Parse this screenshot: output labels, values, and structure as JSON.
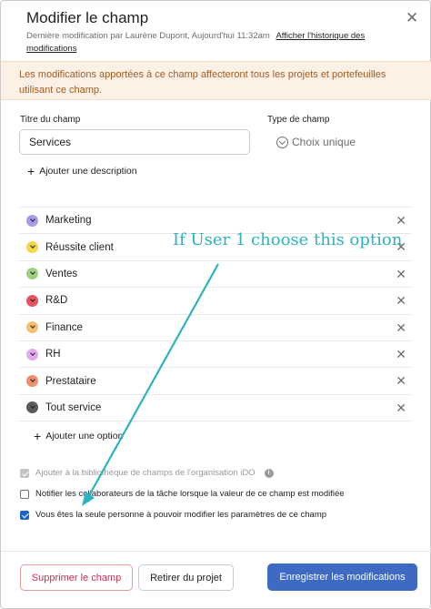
{
  "dialog": {
    "title": "Modifier le champ",
    "meta_text": "Dernière modification par Laurène Dupont, Aujourd'hui 11:32am",
    "history_link": "Afficher l'historique des modifications",
    "warning": "Les modifications apportées à ce champ affecteront tous les projets et portefeuilles utilisant ce champ."
  },
  "form": {
    "name_label": "Titre du champ",
    "name_value": "Services",
    "type_label": "Type de champ",
    "type_value": "Choix unique",
    "add_description": "Ajouter une description"
  },
  "options": [
    {
      "label": "Marketing",
      "color": "#a89ae8"
    },
    {
      "label": "Réussite client",
      "color": "#f2d74a"
    },
    {
      "label": "Ventes",
      "color": "#9bd07e"
    },
    {
      "label": "R&D",
      "color": "#e8525a"
    },
    {
      "label": "Finance",
      "color": "#f4c070"
    },
    {
      "label": "RH",
      "color": "#e2a8f0"
    },
    {
      "label": "Prestataire",
      "color": "#f08f6d"
    },
    {
      "label": "Tout service",
      "color": "#5b5b5b"
    }
  ],
  "add_option": "Ajouter une option",
  "checkboxes": {
    "library": "Ajouter à la bibliothèque de champs de l'organisation iDO",
    "notify": "Notifier les collaborateurs de la tâche lorsque la valeur de ce champ est modifiée",
    "only_you": "Vous êtes la seule personne à pouvoir modifier les paramètres de ce champ"
  },
  "buttons": {
    "delete": "Supprimer le champ",
    "remove": "Retirer du projet",
    "save": "Enregistrer les modifications"
  },
  "annotation": {
    "text": "If User 1 choose this option",
    "color": "#2cb2c0"
  },
  "colors": {
    "primary": "#3f6ac4",
    "danger": "#c92f54",
    "warning_bg": "#fdf1e6",
    "warning_text": "#a05a21"
  }
}
